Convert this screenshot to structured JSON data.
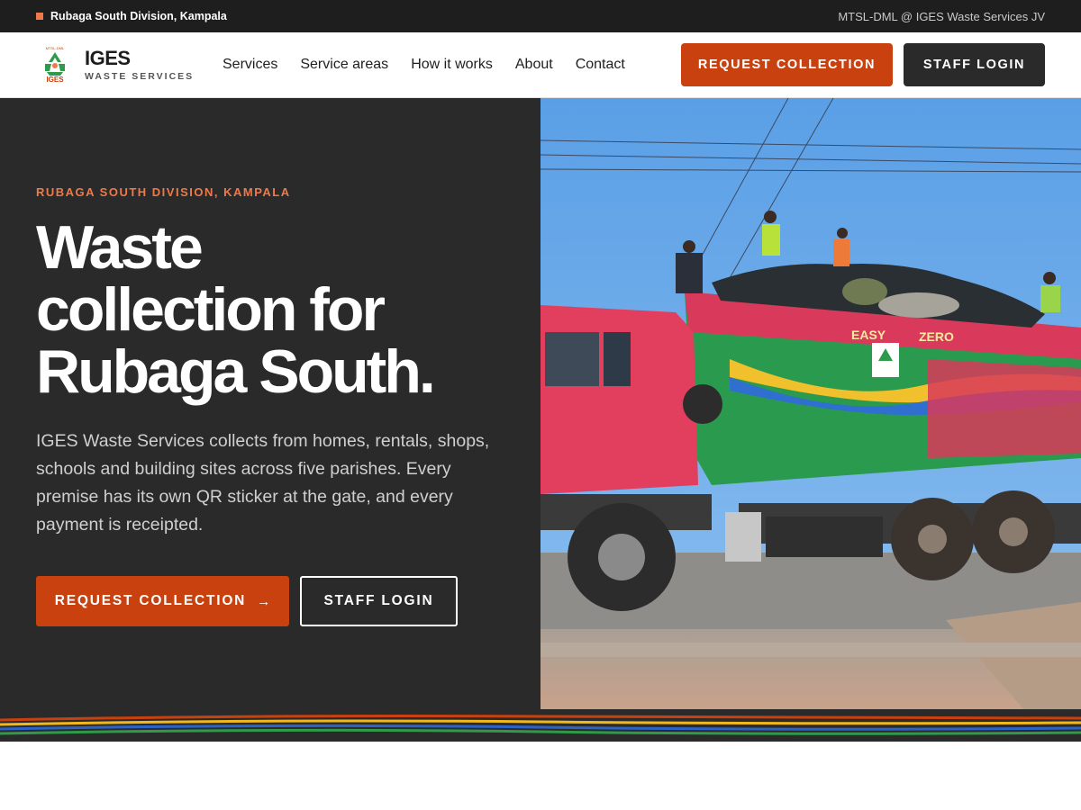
{
  "topbar": {
    "location": "Rubaga South Division, Kampala",
    "jv": "MTSL-DML @ IGES Waste Services JV"
  },
  "brand": {
    "name": "IGES",
    "tagline": "WASTE SERVICES",
    "logo_icon": "recycle-logo-icon"
  },
  "nav": {
    "items": [
      "Services",
      "Service areas",
      "How it works",
      "About",
      "Contact"
    ]
  },
  "header_actions": {
    "request": "REQUEST COLLECTION",
    "login": "STAFF LOGIN"
  },
  "hero": {
    "eyebrow": "RUBAGA SOUTH DIVISION, KAMPALA",
    "headline_line1": "Waste",
    "headline_line2": "collection for",
    "headline_line3": "Rubaga South.",
    "lead": "IGES Waste Services collects from homes, rentals, shops, schools and building sites across five parishes. Every premise has its own QR sticker at the gate, and every payment is receipted.",
    "primary_cta": "REQUEST COLLECTION",
    "primary_cta_icon": "arrow-right-icon",
    "secondary_cta": "STAFF LOGIN"
  },
  "photo": {
    "subject": "waste-collection-truck-photo"
  },
  "colors": {
    "accent": "#c8410f",
    "eyebrow": "#ee7a4a",
    "dark": "#2a2a2a",
    "topbar": "#1e1e1e",
    "stripe_colors": [
      "#c8410f",
      "#f1b81b",
      "#2c63c7",
      "#2e9a4a"
    ]
  }
}
